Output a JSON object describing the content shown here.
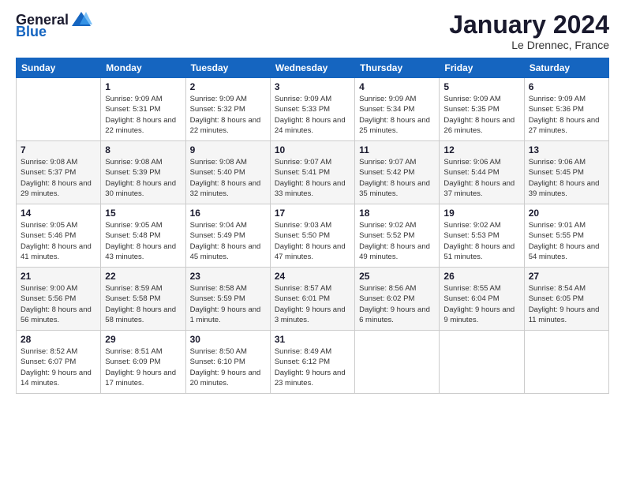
{
  "header": {
    "logo_text_general": "General",
    "logo_text_blue": "Blue",
    "month_title": "January 2024",
    "location": "Le Drennec, France"
  },
  "weekdays": [
    "Sunday",
    "Monday",
    "Tuesday",
    "Wednesday",
    "Thursday",
    "Friday",
    "Saturday"
  ],
  "weeks": [
    [
      {
        "day": "",
        "sunrise": "",
        "sunset": "",
        "daylight": ""
      },
      {
        "day": "1",
        "sunrise": "Sunrise: 9:09 AM",
        "sunset": "Sunset: 5:31 PM",
        "daylight": "Daylight: 8 hours and 22 minutes."
      },
      {
        "day": "2",
        "sunrise": "Sunrise: 9:09 AM",
        "sunset": "Sunset: 5:32 PM",
        "daylight": "Daylight: 8 hours and 22 minutes."
      },
      {
        "day": "3",
        "sunrise": "Sunrise: 9:09 AM",
        "sunset": "Sunset: 5:33 PM",
        "daylight": "Daylight: 8 hours and 24 minutes."
      },
      {
        "day": "4",
        "sunrise": "Sunrise: 9:09 AM",
        "sunset": "Sunset: 5:34 PM",
        "daylight": "Daylight: 8 hours and 25 minutes."
      },
      {
        "day": "5",
        "sunrise": "Sunrise: 9:09 AM",
        "sunset": "Sunset: 5:35 PM",
        "daylight": "Daylight: 8 hours and 26 minutes."
      },
      {
        "day": "6",
        "sunrise": "Sunrise: 9:09 AM",
        "sunset": "Sunset: 5:36 PM",
        "daylight": "Daylight: 8 hours and 27 minutes."
      }
    ],
    [
      {
        "day": "7",
        "sunrise": "Sunrise: 9:08 AM",
        "sunset": "Sunset: 5:37 PM",
        "daylight": "Daylight: 8 hours and 29 minutes."
      },
      {
        "day": "8",
        "sunrise": "Sunrise: 9:08 AM",
        "sunset": "Sunset: 5:39 PM",
        "daylight": "Daylight: 8 hours and 30 minutes."
      },
      {
        "day": "9",
        "sunrise": "Sunrise: 9:08 AM",
        "sunset": "Sunset: 5:40 PM",
        "daylight": "Daylight: 8 hours and 32 minutes."
      },
      {
        "day": "10",
        "sunrise": "Sunrise: 9:07 AM",
        "sunset": "Sunset: 5:41 PM",
        "daylight": "Daylight: 8 hours and 33 minutes."
      },
      {
        "day": "11",
        "sunrise": "Sunrise: 9:07 AM",
        "sunset": "Sunset: 5:42 PM",
        "daylight": "Daylight: 8 hours and 35 minutes."
      },
      {
        "day": "12",
        "sunrise": "Sunrise: 9:06 AM",
        "sunset": "Sunset: 5:44 PM",
        "daylight": "Daylight: 8 hours and 37 minutes."
      },
      {
        "day": "13",
        "sunrise": "Sunrise: 9:06 AM",
        "sunset": "Sunset: 5:45 PM",
        "daylight": "Daylight: 8 hours and 39 minutes."
      }
    ],
    [
      {
        "day": "14",
        "sunrise": "Sunrise: 9:05 AM",
        "sunset": "Sunset: 5:46 PM",
        "daylight": "Daylight: 8 hours and 41 minutes."
      },
      {
        "day": "15",
        "sunrise": "Sunrise: 9:05 AM",
        "sunset": "Sunset: 5:48 PM",
        "daylight": "Daylight: 8 hours and 43 minutes."
      },
      {
        "day": "16",
        "sunrise": "Sunrise: 9:04 AM",
        "sunset": "Sunset: 5:49 PM",
        "daylight": "Daylight: 8 hours and 45 minutes."
      },
      {
        "day": "17",
        "sunrise": "Sunrise: 9:03 AM",
        "sunset": "Sunset: 5:50 PM",
        "daylight": "Daylight: 8 hours and 47 minutes."
      },
      {
        "day": "18",
        "sunrise": "Sunrise: 9:02 AM",
        "sunset": "Sunset: 5:52 PM",
        "daylight": "Daylight: 8 hours and 49 minutes."
      },
      {
        "day": "19",
        "sunrise": "Sunrise: 9:02 AM",
        "sunset": "Sunset: 5:53 PM",
        "daylight": "Daylight: 8 hours and 51 minutes."
      },
      {
        "day": "20",
        "sunrise": "Sunrise: 9:01 AM",
        "sunset": "Sunset: 5:55 PM",
        "daylight": "Daylight: 8 hours and 54 minutes."
      }
    ],
    [
      {
        "day": "21",
        "sunrise": "Sunrise: 9:00 AM",
        "sunset": "Sunset: 5:56 PM",
        "daylight": "Daylight: 8 hours and 56 minutes."
      },
      {
        "day": "22",
        "sunrise": "Sunrise: 8:59 AM",
        "sunset": "Sunset: 5:58 PM",
        "daylight": "Daylight: 8 hours and 58 minutes."
      },
      {
        "day": "23",
        "sunrise": "Sunrise: 8:58 AM",
        "sunset": "Sunset: 5:59 PM",
        "daylight": "Daylight: 9 hours and 1 minute."
      },
      {
        "day": "24",
        "sunrise": "Sunrise: 8:57 AM",
        "sunset": "Sunset: 6:01 PM",
        "daylight": "Daylight: 9 hours and 3 minutes."
      },
      {
        "day": "25",
        "sunrise": "Sunrise: 8:56 AM",
        "sunset": "Sunset: 6:02 PM",
        "daylight": "Daylight: 9 hours and 6 minutes."
      },
      {
        "day": "26",
        "sunrise": "Sunrise: 8:55 AM",
        "sunset": "Sunset: 6:04 PM",
        "daylight": "Daylight: 9 hours and 9 minutes."
      },
      {
        "day": "27",
        "sunrise": "Sunrise: 8:54 AM",
        "sunset": "Sunset: 6:05 PM",
        "daylight": "Daylight: 9 hours and 11 minutes."
      }
    ],
    [
      {
        "day": "28",
        "sunrise": "Sunrise: 8:52 AM",
        "sunset": "Sunset: 6:07 PM",
        "daylight": "Daylight: 9 hours and 14 minutes."
      },
      {
        "day": "29",
        "sunrise": "Sunrise: 8:51 AM",
        "sunset": "Sunset: 6:09 PM",
        "daylight": "Daylight: 9 hours and 17 minutes."
      },
      {
        "day": "30",
        "sunrise": "Sunrise: 8:50 AM",
        "sunset": "Sunset: 6:10 PM",
        "daylight": "Daylight: 9 hours and 20 minutes."
      },
      {
        "day": "31",
        "sunrise": "Sunrise: 8:49 AM",
        "sunset": "Sunset: 6:12 PM",
        "daylight": "Daylight: 9 hours and 23 minutes."
      },
      {
        "day": "",
        "sunrise": "",
        "sunset": "",
        "daylight": ""
      },
      {
        "day": "",
        "sunrise": "",
        "sunset": "",
        "daylight": ""
      },
      {
        "day": "",
        "sunrise": "",
        "sunset": "",
        "daylight": ""
      }
    ]
  ]
}
